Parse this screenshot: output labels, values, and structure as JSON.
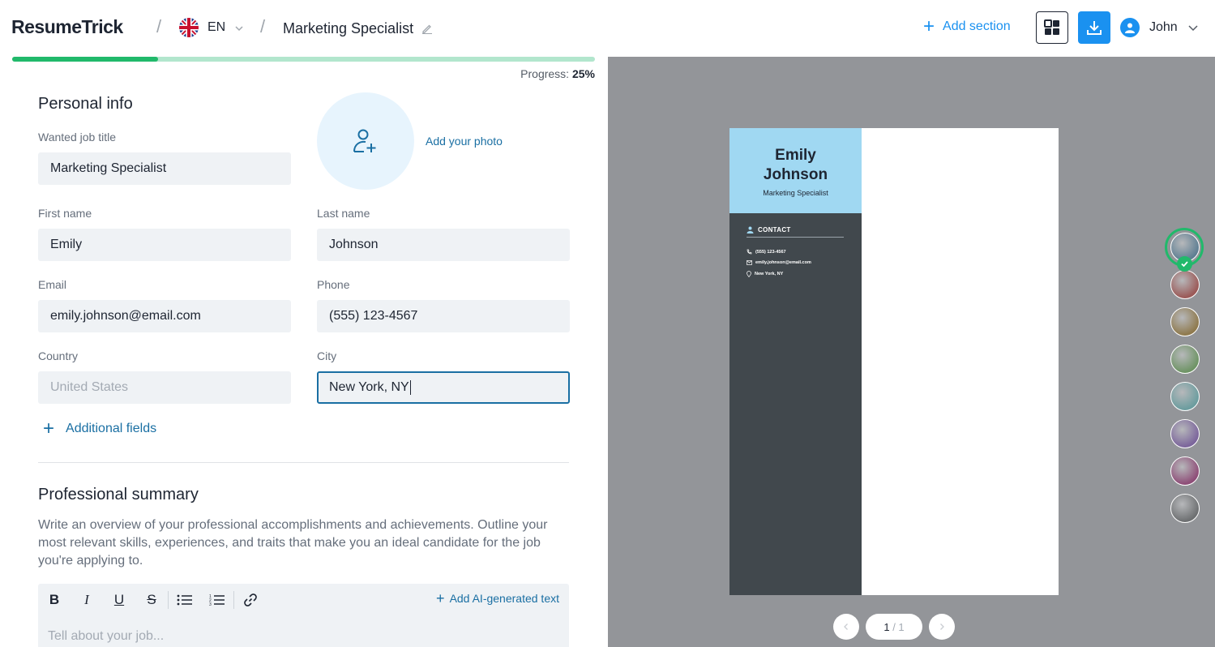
{
  "header": {
    "logo_part1": "Resume",
    "logo_part2": "Trick",
    "language": "EN",
    "document_title": "Marketing Specialist",
    "add_section_label": "Add section",
    "user_name": "John",
    "accent_color": "#1a91f0"
  },
  "progress": {
    "label": "Progress:",
    "value_text": "25%",
    "fraction": 0.25
  },
  "personal_info": {
    "title": "Personal info",
    "add_photo_label": "Add your photo",
    "wanted_job_title_label": "Wanted job title",
    "wanted_job_title_value": "Marketing Specialist",
    "first_name_label": "First name",
    "first_name_value": "Emily",
    "last_name_label": "Last name",
    "last_name_value": "Johnson",
    "email_label": "Email",
    "email_value": "emily.johnson@email.com",
    "phone_label": "Phone",
    "phone_value": "(555) 123-4567",
    "country_label": "Country",
    "country_placeholder": "United States",
    "city_label": "City",
    "city_value": "New York, NY",
    "additional_fields_label": "Additional fields"
  },
  "professional_summary": {
    "title": "Professional summary",
    "description": "Write an overview of your professional accomplishments and achievements. Outline your most relevant skills, experiences, and traits that make you an ideal candidate for the job you're applying to.",
    "toolbar": {
      "bold": "B",
      "italic": "I",
      "underline": "U",
      "strike": "S"
    },
    "ai_label": "Add AI-generated text",
    "editor_placeholder": "Tell about your job..."
  },
  "preview": {
    "first_name": "Emily",
    "last_name": "Johnson",
    "job_title": "Marketing Specialist",
    "contact_heading": "CONTACT",
    "phone": "(555) 123-4567",
    "email": "emily.johnson@email.com",
    "location": "New York, NY",
    "page_current": "1",
    "page_total": "/ 1",
    "header_color": "#a0d8f2",
    "sidebar_color": "#41484d"
  },
  "color_swatches": [
    {
      "name": "blue-gray",
      "color": "#5f7f93",
      "selected": true
    },
    {
      "name": "red",
      "color": "#9b5a58",
      "selected": false
    },
    {
      "name": "gold",
      "color": "#8f7a4e",
      "selected": false
    },
    {
      "name": "green",
      "color": "#6f9466",
      "selected": false
    },
    {
      "name": "teal",
      "color": "#6c9d9f",
      "selected": false
    },
    {
      "name": "purple",
      "color": "#7c669c",
      "selected": false
    },
    {
      "name": "magenta",
      "color": "#8e4e78",
      "selected": false
    },
    {
      "name": "gray",
      "color": "#6e7072",
      "selected": false
    }
  ]
}
